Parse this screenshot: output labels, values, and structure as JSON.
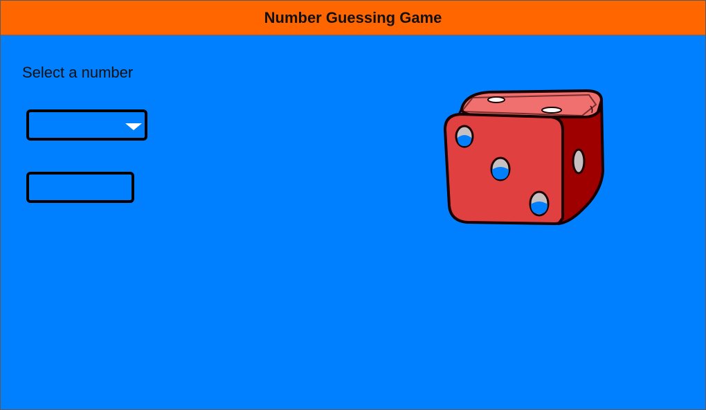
{
  "header": {
    "title": "Number Guessing Game"
  },
  "main": {
    "prompt_label": "Select a number",
    "number_select": {
      "selected_value": ""
    },
    "guess_input": {
      "value": ""
    },
    "dice": {
      "icon": "dice-icon",
      "face_value": 3
    }
  },
  "colors": {
    "header_background": "#ff6600",
    "page_background": "#0080ff",
    "dice_red": "#e04040",
    "dice_dark_red": "#a00000"
  }
}
